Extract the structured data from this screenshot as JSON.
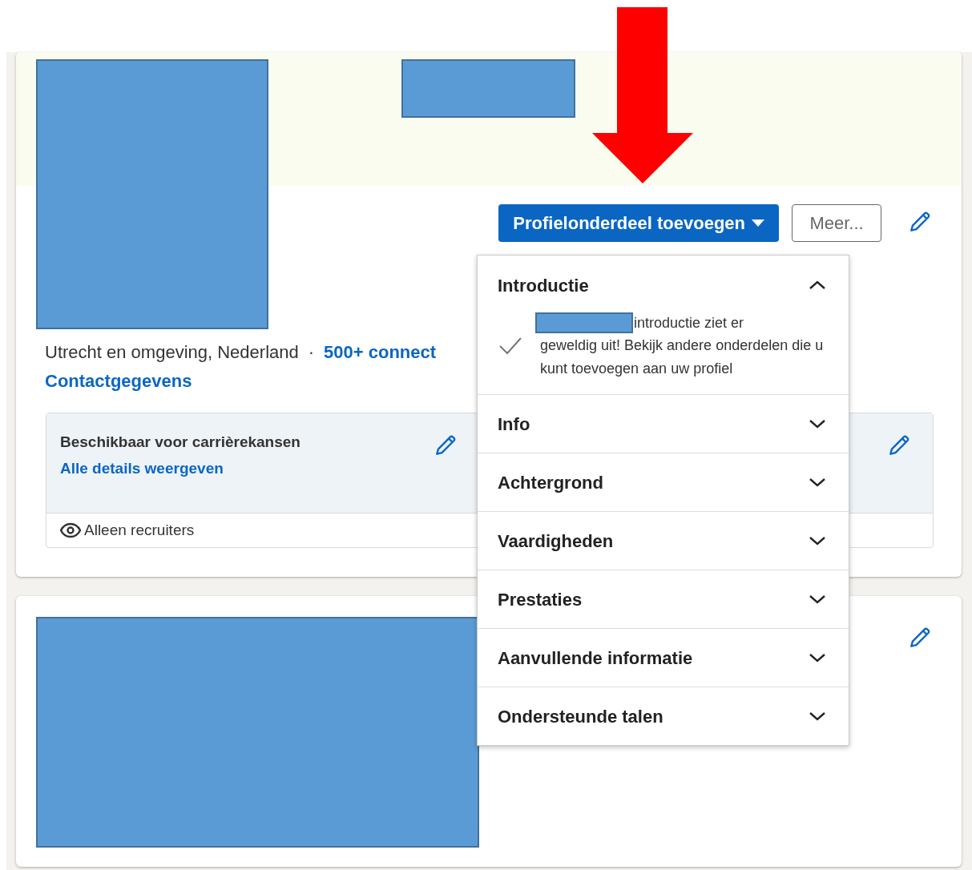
{
  "profile_card": {
    "location": "Utrecht en omgeving, Nederland",
    "separator": "·",
    "connections_link": "500+ connect",
    "contact_link": "Contactgegevens",
    "add_section_button": "Profielonderdeel toevoegen",
    "more_button": "Meer...",
    "career_box": {
      "title": "Beschikbaar voor carrièrekansen",
      "details_link": "Alle details weergeven",
      "visibility": "Alleen recruiters"
    }
  },
  "dropdown": {
    "sections": [
      {
        "label": "Introductie",
        "expanded": true,
        "done": true,
        "message_first_line": "introductie ziet er",
        "message_rest": "geweldig uit! Bekijk andere onderdelen die u kunt toevoegen aan uw profiel"
      },
      {
        "label": "Info",
        "expanded": false
      },
      {
        "label": "Achtergrond",
        "expanded": false
      },
      {
        "label": "Vaardigheden",
        "expanded": false
      },
      {
        "label": "Prestaties",
        "expanded": false
      },
      {
        "label": "Aanvullende informatie",
        "expanded": false
      },
      {
        "label": "Ondersteunde talen",
        "expanded": false
      }
    ]
  }
}
